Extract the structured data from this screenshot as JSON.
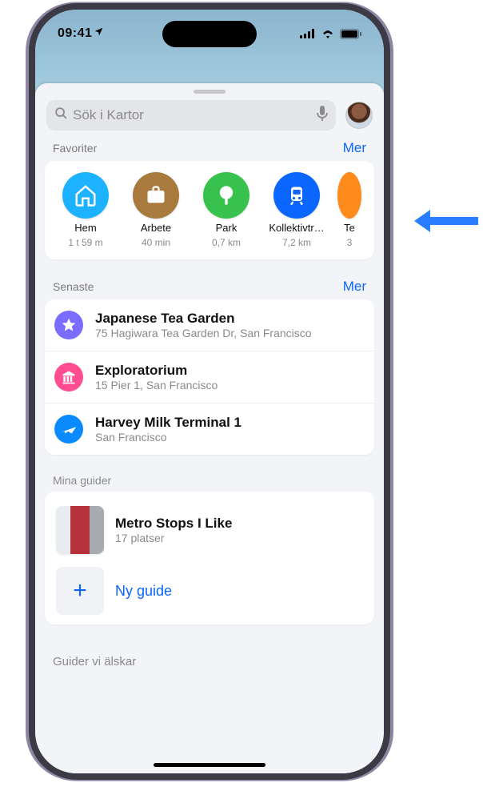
{
  "status": {
    "time": "09:41"
  },
  "search": {
    "placeholder": "Sök i Kartor"
  },
  "links": {
    "more": "Mer"
  },
  "sections": {
    "favorites_title": "Favoriter",
    "recents_title": "Senaste",
    "guides_title": "Mina guider",
    "loved_title": "Guider vi älskar"
  },
  "favorites": [
    {
      "icon": "home",
      "color": "c-blue",
      "label": "Hem",
      "sub": "1 t 59 m"
    },
    {
      "icon": "work",
      "color": "c-brown",
      "label": "Arbete",
      "sub": "40 min"
    },
    {
      "icon": "tree",
      "color": "c-green",
      "label": "Park",
      "sub": "0,7 km"
    },
    {
      "icon": "train",
      "color": "c-train",
      "label": "Kollektivtr…",
      "sub": "7,2 km"
    },
    {
      "icon": "te",
      "color": "c-orange",
      "label": "Te",
      "sub": "3"
    }
  ],
  "recents": [
    {
      "icon": "star",
      "color": "r-purple",
      "title": "Japanese Tea Garden",
      "sub": "75 Hagiwara Tea Garden Dr, San Francisco"
    },
    {
      "icon": "museum",
      "color": "r-pink",
      "title": "Exploratorium",
      "sub": "15 Pier 1, San Francisco"
    },
    {
      "icon": "plane",
      "color": "r-takeoff",
      "title": "Harvey Milk Terminal 1",
      "sub": "San Francisco"
    }
  ],
  "guides": {
    "items": [
      {
        "title": "Metro Stops I Like",
        "sub": "17 platser"
      }
    ],
    "new_label": "Ny guide"
  }
}
